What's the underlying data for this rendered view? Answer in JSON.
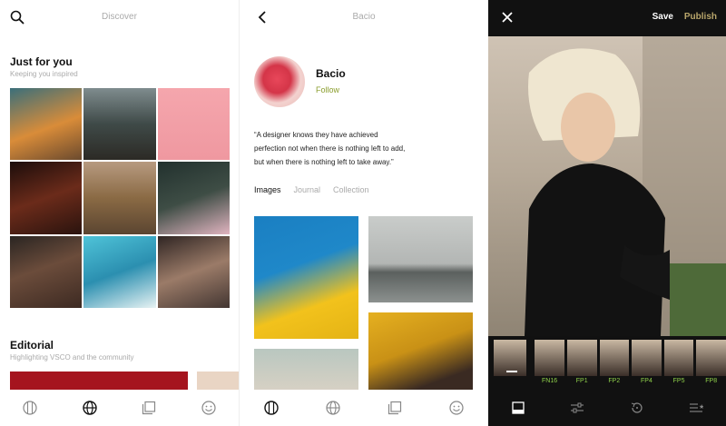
{
  "discover": {
    "title": "Discover",
    "just_for_you": {
      "title": "Just for you",
      "subtitle": "Keeping you inspired"
    },
    "editorial": {
      "title": "Editorial",
      "subtitle": "Highlighting VSCO and the community"
    },
    "icons": [
      "search-icon"
    ],
    "nav": [
      "studio-icon",
      "discover-icon",
      "library-icon",
      "profile-icon"
    ]
  },
  "profile": {
    "title": "Bacio",
    "name": "Bacio",
    "follow": "Follow",
    "quote_1": "“A designer knows they have achieved",
    "quote_2": "perfection not when there is nothing left to add,",
    "quote_3": "but when there is nothing left to take away.”",
    "tabs": [
      "Images",
      "Journal",
      "Collection"
    ]
  },
  "editor": {
    "save": "Save",
    "publish": "Publish",
    "presets": [
      "FN16",
      "FP1",
      "FP2",
      "FP4",
      "FP5",
      "FP8"
    ],
    "accent_color": "#b9a66b",
    "preset_label_color": "#8fd14a"
  }
}
